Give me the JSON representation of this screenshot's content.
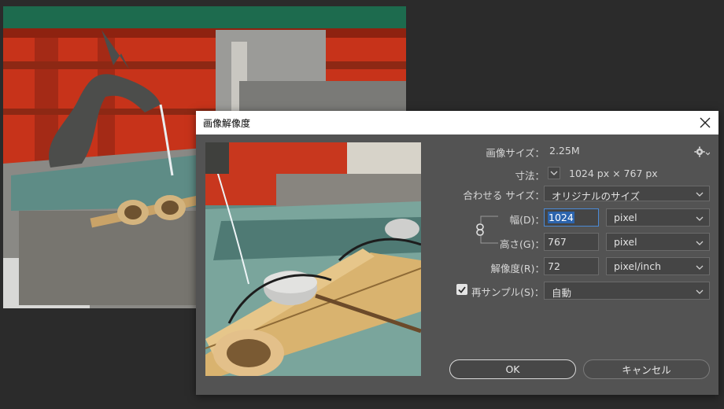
{
  "dialog": {
    "title": "画像解像度",
    "close_icon": "close-icon"
  },
  "size_row": {
    "label": "画像サイズ：",
    "value": "2.25M",
    "settings_icon": "gear-icon"
  },
  "dimensions_row": {
    "label": "寸法：",
    "value": "1024 px × 767 px",
    "toggle_icon": "chevron-down-icon"
  },
  "fit_row": {
    "label": "合わせる サイズ：",
    "selected": "オリジナルのサイズ"
  },
  "width_row": {
    "label": "幅(D)：",
    "value": "1024",
    "unit": "pixel"
  },
  "height_row": {
    "label": "高さ(G)：",
    "value": "767",
    "unit": "pixel"
  },
  "link_icon": "chain-link-icon",
  "resolution_row": {
    "label": "解像度(R)：",
    "value": "72",
    "unit": "pixel/inch"
  },
  "resample_row": {
    "label": "再サンプル(S)：",
    "checked": true,
    "selected": "自動"
  },
  "buttons": {
    "ok": "OK",
    "cancel": "キャンセル"
  },
  "colors": {
    "dialog_bg": "#535353",
    "field_bg": "#454545",
    "focus": "#4b8ad6",
    "selection": "#2c64ad"
  }
}
